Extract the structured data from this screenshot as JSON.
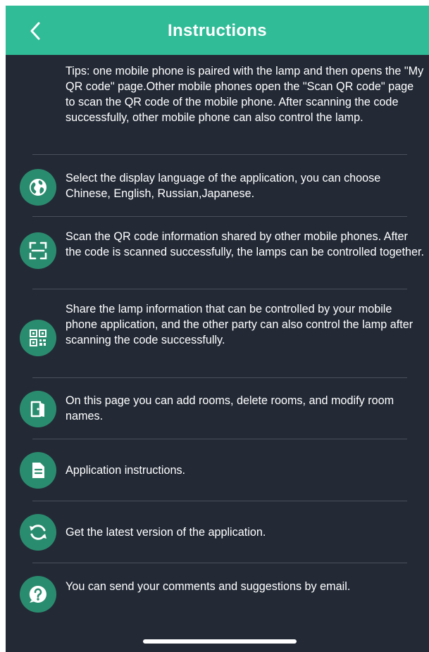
{
  "header": {
    "title": "Instructions",
    "back_icon": "chevron-left-icon"
  },
  "tips": "Tips: one mobile phone is paired with the lamp and then opens the \"My QR code\" page.Other mobile phones open the \"Scan QR code\" page to scan the QR code of the mobile phone. After scanning the code successfully, other mobile phone can also control the lamp.",
  "items": [
    {
      "icon": "globe-icon",
      "text": "Select the display language of the application, you can choose Chinese, English, Russian,Japanese."
    },
    {
      "icon": "scan-icon",
      "text": "Scan the QR code information shared by other mobile phones. After the code is scanned successfully, the lamps can be controlled together."
    },
    {
      "icon": "qr-code-icon",
      "text": "Share the lamp information that can be controlled by your mobile phone application, and the other party can also control the lamp after scanning the code successfully."
    },
    {
      "icon": "door-icon",
      "text": "On this page you can add rooms, delete rooms, and modify room names."
    },
    {
      "icon": "document-icon",
      "text": "Application instructions."
    },
    {
      "icon": "refresh-icon",
      "text": "Get the latest version of the application."
    },
    {
      "icon": "question-icon",
      "text": "You can send your comments and suggestions by email."
    }
  ],
  "colors": {
    "header": "#2fbc97",
    "background": "#232a36",
    "icon_circle": "#2a8c6e",
    "text": "#ffffff"
  }
}
